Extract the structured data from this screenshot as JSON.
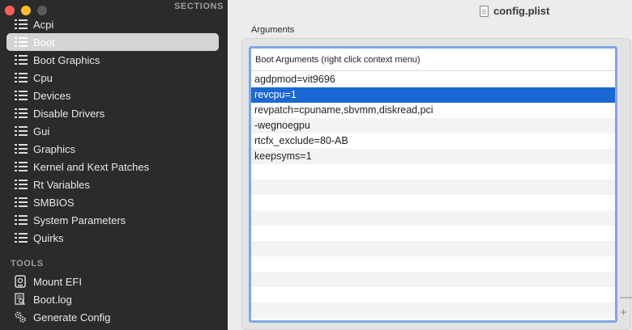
{
  "window": {
    "title": "config.plist",
    "file_icon": "document-icon"
  },
  "sidebar": {
    "sections_header": "SECTIONS",
    "items": [
      {
        "label": "Acpi",
        "selected": false
      },
      {
        "label": "Boot",
        "selected": true
      },
      {
        "label": "Boot Graphics",
        "selected": false
      },
      {
        "label": "Cpu",
        "selected": false
      },
      {
        "label": "Devices",
        "selected": false
      },
      {
        "label": "Disable Drivers",
        "selected": false
      },
      {
        "label": "Gui",
        "selected": false
      },
      {
        "label": "Graphics",
        "selected": false
      },
      {
        "label": "Kernel and Kext Patches",
        "selected": false
      },
      {
        "label": "Rt Variables",
        "selected": false
      },
      {
        "label": "SMBIOS",
        "selected": false
      },
      {
        "label": "System Parameters",
        "selected": false
      },
      {
        "label": "Quirks",
        "selected": false
      }
    ],
    "tools_header": "TOOLS",
    "tools": [
      {
        "label": "Mount EFI",
        "icon": "disk-icon"
      },
      {
        "label": "Boot.log",
        "icon": "log-search-icon"
      },
      {
        "label": "Generate Config",
        "icon": "gears-icon"
      }
    ]
  },
  "main": {
    "group_label": "Arguments",
    "table": {
      "header": "Boot Arguments (right click context menu)",
      "rows": [
        {
          "value": "agdpmod=vit9696",
          "selected": false
        },
        {
          "value": "revcpu=1",
          "selected": true
        },
        {
          "value": "revpatch=cpuname,sbvmm,diskread,pci",
          "selected": false
        },
        {
          "value": "-wegnoegpu",
          "selected": false
        },
        {
          "value": "rtcfx_exclude=80-AB",
          "selected": false
        },
        {
          "value": "keepsyms=1",
          "selected": false
        }
      ]
    },
    "remove_label": "—",
    "add_label": "+"
  },
  "colors": {
    "sidebar_bg": "#2b2b2b",
    "selection_blue": "#1a67d4",
    "focus_ring": "#7fa7e6",
    "close": "#fe5f57",
    "minimize": "#febc2e"
  }
}
